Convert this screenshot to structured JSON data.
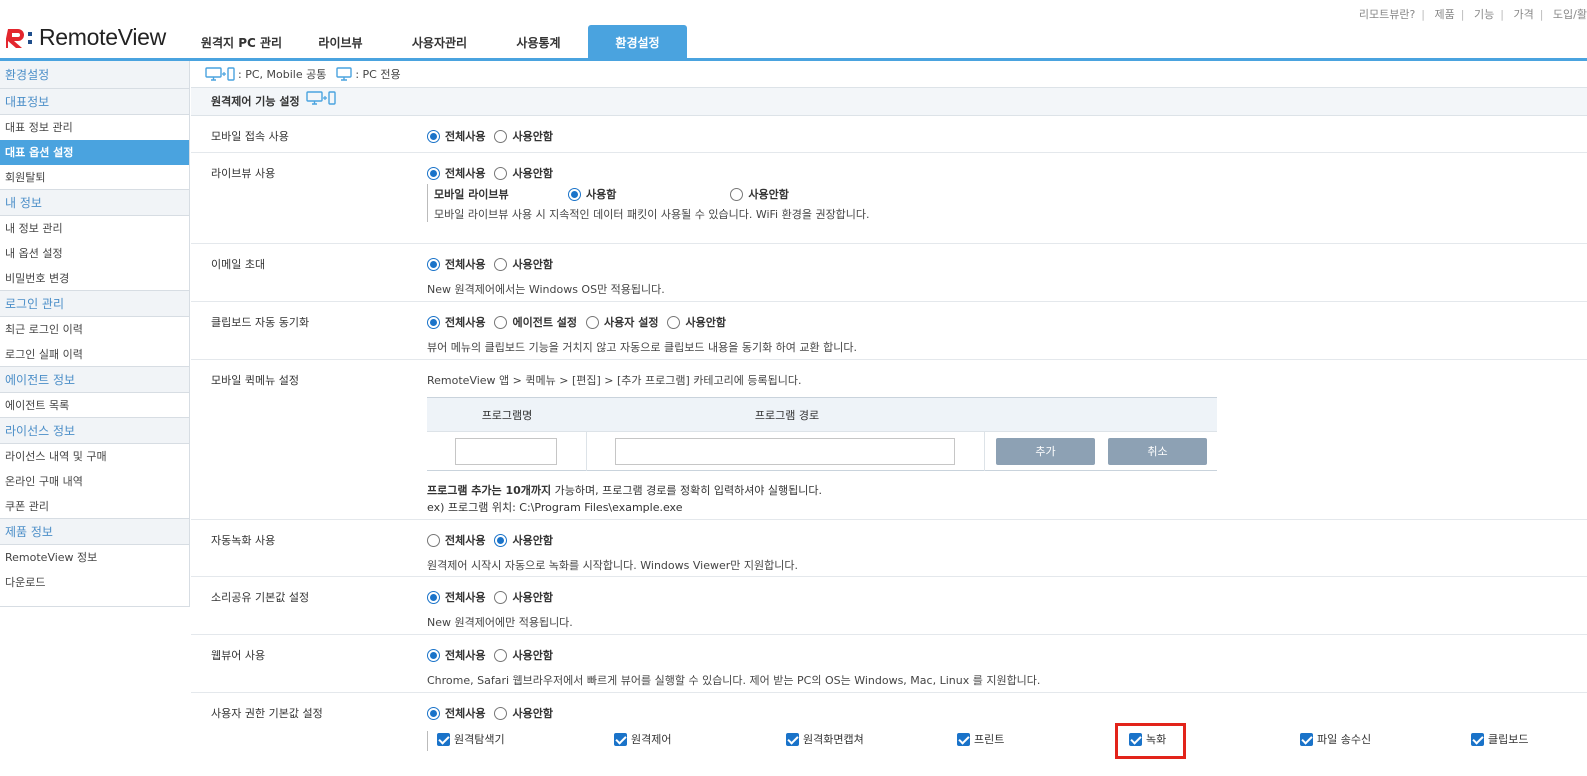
{
  "header": {
    "logo_text": "RemoteView",
    "top_links": [
      "리모트뷰란?",
      "제품",
      "기능",
      "가격",
      "도입/활"
    ],
    "tabs": [
      "원격지 PC 관리",
      "라이브뷰",
      "사용자관리",
      "사용통계",
      "환경설정"
    ],
    "active_tab": "환경설정",
    "colors": {
      "accent": "#4aa3df",
      "brand_red": "#e3262e",
      "brand_blue": "#1f4e8c"
    }
  },
  "sidebar": {
    "title": "환경설정",
    "groups": [
      {
        "category": "대표정보",
        "items": [
          "대표 정보 관리",
          "대표 옵션 설정",
          "회원탈퇴"
        ]
      },
      {
        "category": "내 정보",
        "items": [
          "내 정보 관리",
          "내 옵션 설정",
          "비밀번호 변경"
        ]
      },
      {
        "category": "로그인 관리",
        "items": [
          "최근 로그인 이력",
          "로그인 실패 이력"
        ]
      },
      {
        "category": "에이전트 정보",
        "items": [
          "에이전트 목록"
        ]
      },
      {
        "category": "라이선스 정보",
        "items": [
          "라이선스 내역 및 구매",
          "온라인 구매 내역",
          "쿠폰 관리"
        ]
      },
      {
        "category": "제품 정보",
        "items": [
          "RemoteView 정보",
          "다운로드"
        ]
      }
    ],
    "active_item": "대표 옵션 설정"
  },
  "legend": {
    "common": ": PC, Mobile 공통",
    "pc_only": ": PC 전용"
  },
  "section_title": "원격제어 기능 설정",
  "settings": {
    "mobile_access": {
      "label": "모바일 접속 사용",
      "options": [
        "전체사용",
        "사용안함"
      ],
      "selected": "전체사용"
    },
    "liveview": {
      "label": "라이브뷰 사용",
      "options": [
        "전체사용",
        "사용안함"
      ],
      "selected": "전체사용",
      "sub_title": "모바일 라이브뷰",
      "sub_options": [
        "사용함",
        "사용안함"
      ],
      "sub_selected": "사용함",
      "desc": "모바일 라이브뷰 사용 시 지속적인 데이터 패킷이 사용될 수 있습니다. WiFi 환경을 권장합니다."
    },
    "email_invite": {
      "label": "이메일 초대",
      "options": [
        "전체사용",
        "사용안함"
      ],
      "selected": "전체사용",
      "desc": "New 원격제어에서는 Windows OS만 적용됩니다."
    },
    "clipboard": {
      "label": "클립보드 자동 동기화",
      "options": [
        "전체사용",
        "에이전트 설정",
        "사용자 설정",
        "사용안함"
      ],
      "selected": "전체사용",
      "desc": "뷰어 메뉴의 클립보드 기능을 거치지 않고 자동으로 클립보드 내용을 동기화 하여 교환 합니다."
    },
    "quick_menu": {
      "label": "모바일 퀵메뉴 설정",
      "intro": "RemoteView 앱 > 퀵메뉴 > [편집] > [추가 프로그램] 카테고리에 등록됩니다.",
      "col_name": "프로그램명",
      "col_path": "프로그램 경로",
      "name_value": "",
      "path_value": "",
      "add_button": "추가",
      "cancel_button": "취소",
      "note_bold": "프로그램 추가는 10개까지",
      "note_rest": " 가능하며, 프로그램 경로를 정확히 입력하셔야 실행됩니다.",
      "example": "ex) 프로그램 위치: C:\\Program Files\\example.exe"
    },
    "auto_record": {
      "label": "자동녹화 사용",
      "options": [
        "전체사용",
        "사용안함"
      ],
      "selected": "사용안함",
      "desc": "원격제어 시작시 자동으로 녹화를 시작합니다. Windows Viewer만 지원합니다."
    },
    "sound_share": {
      "label": "소리공유 기본값 설정",
      "options": [
        "전체사용",
        "사용안함"
      ],
      "selected": "전체사용",
      "desc": "New 원격제어에만 적용됩니다."
    },
    "web_viewer": {
      "label": "웹뷰어 사용",
      "options": [
        "전체사용",
        "사용안함"
      ],
      "selected": "전체사용",
      "desc": "Chrome, Safari 웹브라우저에서 빠르게 뷰어를 실행할 수 있습니다. 제어 받는 PC의 OS는 Windows, Mac, Linux 를 지원합니다."
    },
    "user_permission": {
      "label": "사용자 권한 기본값 설정",
      "options": [
        "전체사용",
        "사용안함"
      ],
      "selected": "전체사용",
      "permissions": [
        "원격탐색기",
        "원격제어",
        "원격화면캡쳐",
        "프린트",
        "녹화",
        "파일 송수신",
        "클립보드"
      ],
      "highlighted": "녹화"
    }
  }
}
